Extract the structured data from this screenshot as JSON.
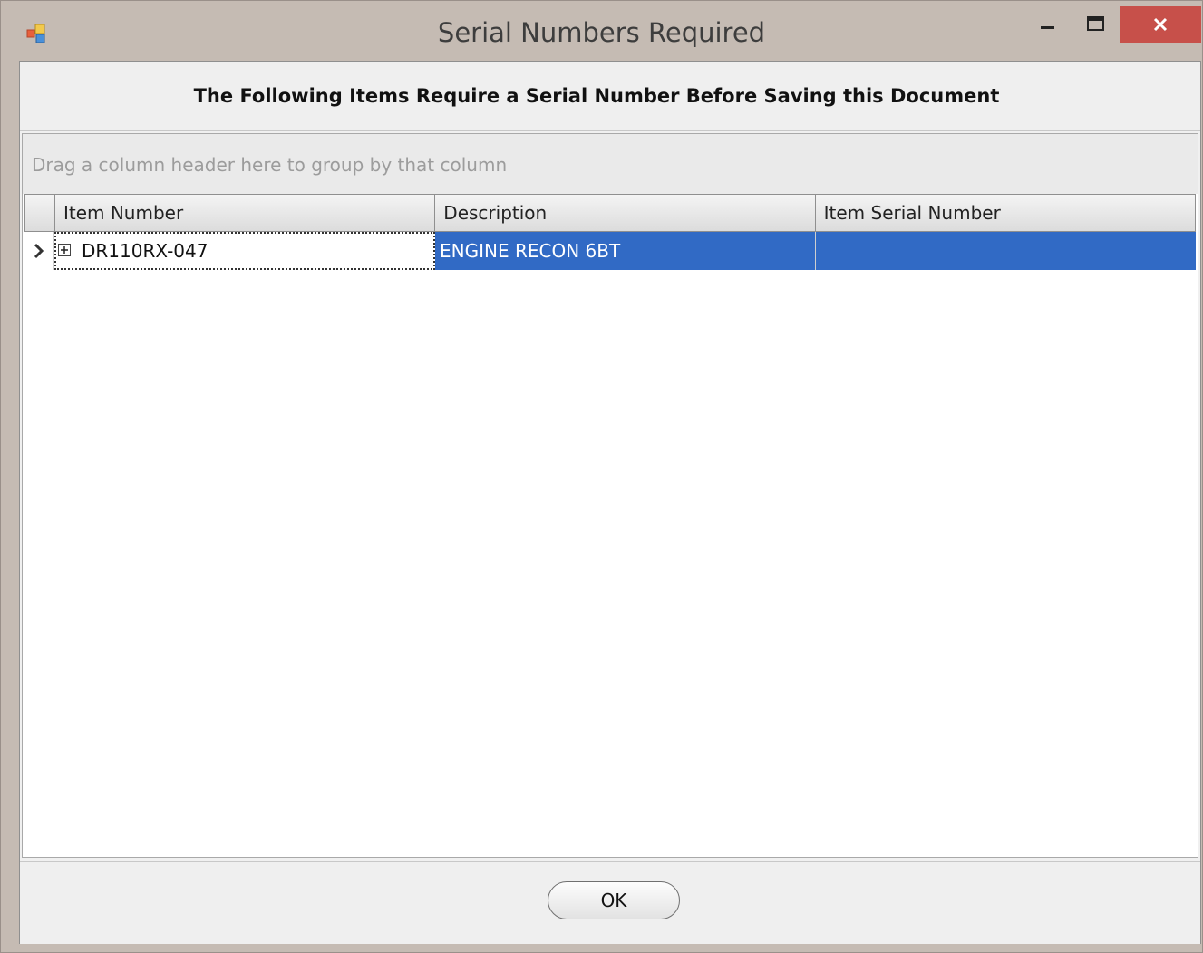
{
  "window": {
    "title": "Serial Numbers Required",
    "controls": {
      "minimize": "minimize-icon",
      "maximize": "maximize-icon",
      "close": "close-icon"
    },
    "close_color": "#c7504a"
  },
  "header": {
    "message": "The Following Items Require a Serial Number Before Saving this Document"
  },
  "grid": {
    "group_hint": "Drag a column header here to group by that column",
    "columns": [
      "Item Number",
      "Description",
      "Item Serial Number"
    ],
    "rows": [
      {
        "item_number": "DR110RX-047",
        "description": "ENGINE RECON 6BT",
        "serial_number": ""
      }
    ],
    "selection_color": "#316ac5"
  },
  "footer": {
    "ok_label": "OK"
  }
}
